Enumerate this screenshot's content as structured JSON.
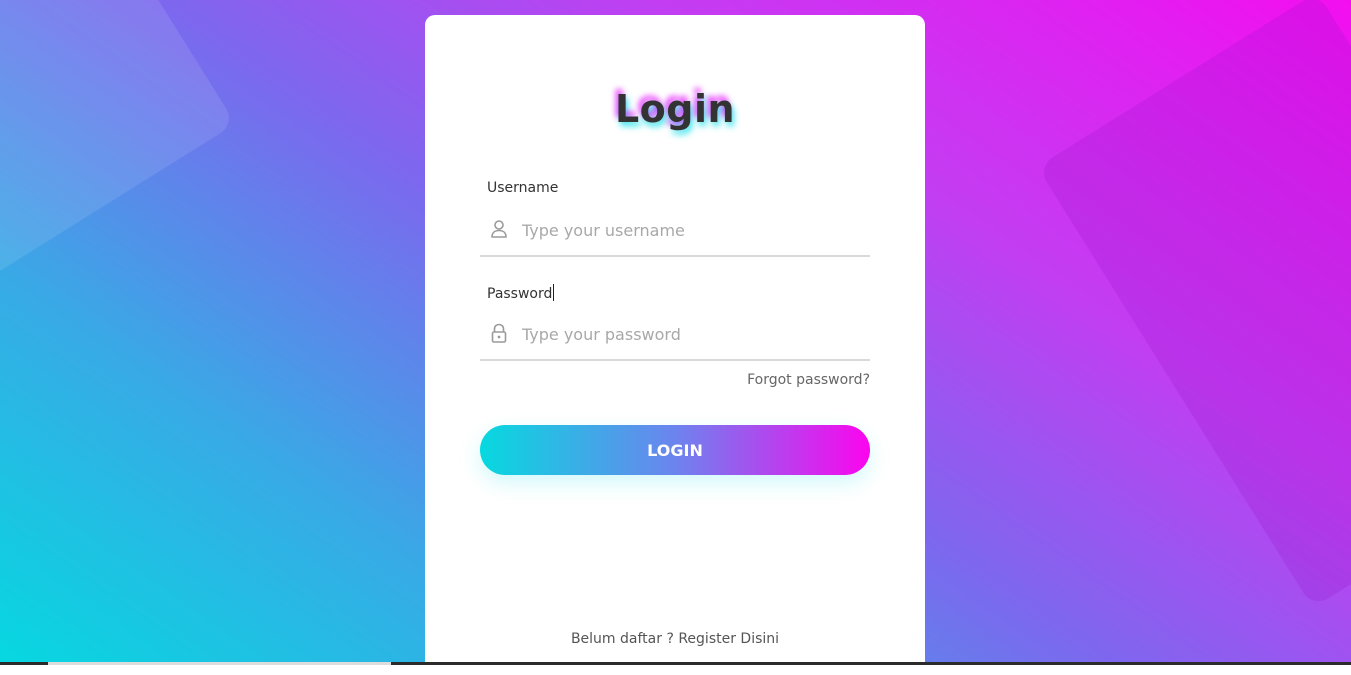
{
  "form": {
    "title": "Login",
    "username": {
      "label": "Username",
      "placeholder": "Type your username",
      "icon": "user-icon"
    },
    "password": {
      "label": "Password",
      "placeholder": "Type your password",
      "icon": "lock-icon"
    },
    "forgot_label": "Forgot password?",
    "login_label": "LOGIN",
    "register_label": "Belum daftar ? Register Disini"
  },
  "colors": {
    "gradient_start": "#06d9df",
    "gradient_mid": "#6c84ee",
    "gradient_end": "#fb05ee",
    "card": "#ffffff",
    "text": "#333333"
  }
}
